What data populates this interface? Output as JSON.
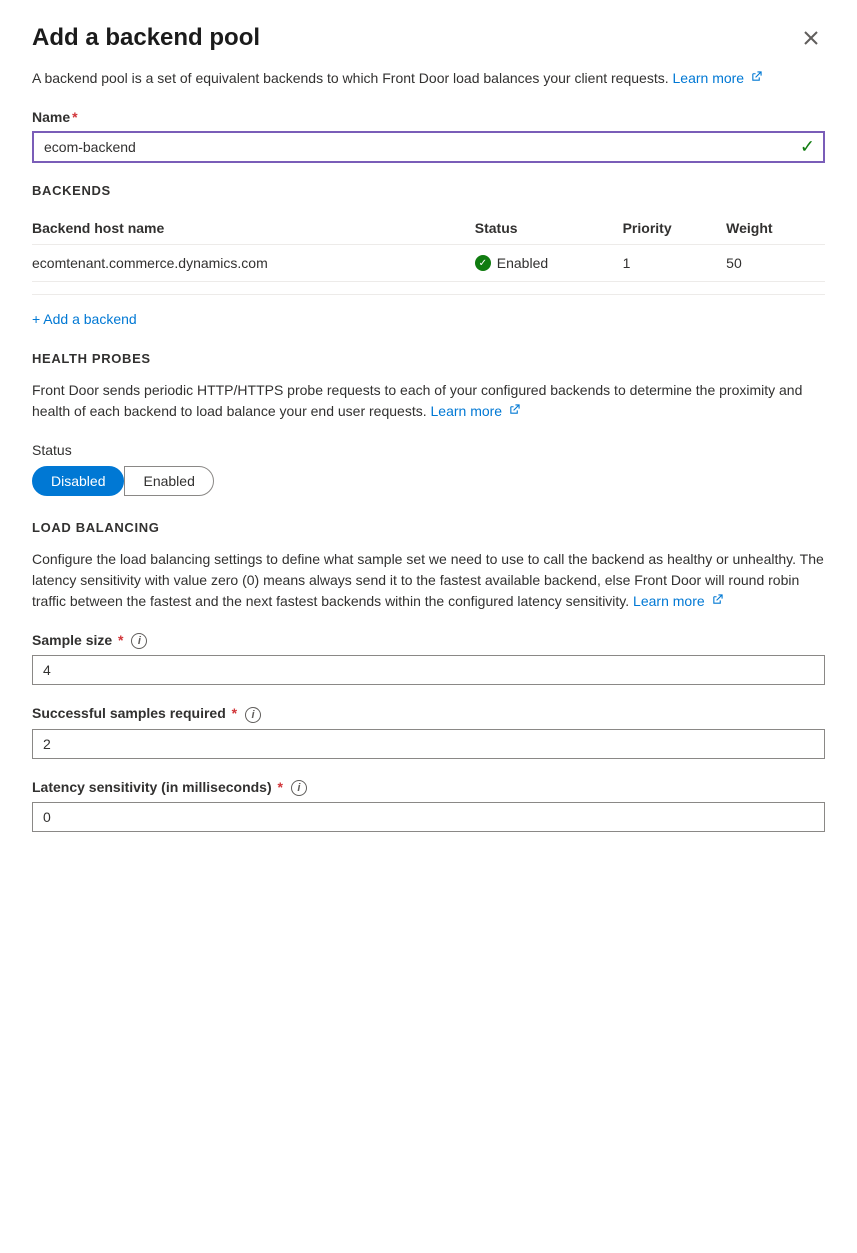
{
  "panel": {
    "title": "Add a backend pool",
    "description": "A backend pool is a set of equivalent backends to which Front Door load balances your client requests.",
    "learn_more_text": "Learn more",
    "close_label": "×"
  },
  "name_field": {
    "label": "Name",
    "value": "ecom-backend",
    "required": true
  },
  "backends_section": {
    "title": "BACKENDS",
    "columns": [
      "Backend host name",
      "Status",
      "Priority",
      "Weight"
    ],
    "rows": [
      {
        "host": "ecomtenant.commerce.dynamics.com",
        "status": "Enabled",
        "priority": "1",
        "weight": "50"
      }
    ],
    "add_label": "+ Add a backend"
  },
  "health_probes_section": {
    "title": "HEALTH PROBES",
    "description": "Front Door sends periodic HTTP/HTTPS probe requests to each of your configured backends to determine the proximity and health of each backend to load balance your end user requests.",
    "learn_more_text": "Learn more",
    "status_label": "Status",
    "toggle_options": [
      "Disabled",
      "Enabled"
    ],
    "active_toggle": "Disabled"
  },
  "load_balancing_section": {
    "title": "LOAD BALANCING",
    "description": "Configure the load balancing settings to define what sample set we need to use to call the backend as healthy or unhealthy. The latency sensitivity with value zero (0) means always send it to the fastest available backend, else Front Door will round robin traffic between the fastest and the next fastest backends within the configured latency sensitivity.",
    "learn_more_text": "Learn more",
    "sample_size": {
      "label": "Sample size",
      "value": "4",
      "required": true
    },
    "successful_samples": {
      "label": "Successful samples required",
      "value": "2",
      "required": true
    },
    "latency_sensitivity": {
      "label": "Latency sensitivity (in milliseconds)",
      "value": "0",
      "required": true
    }
  }
}
